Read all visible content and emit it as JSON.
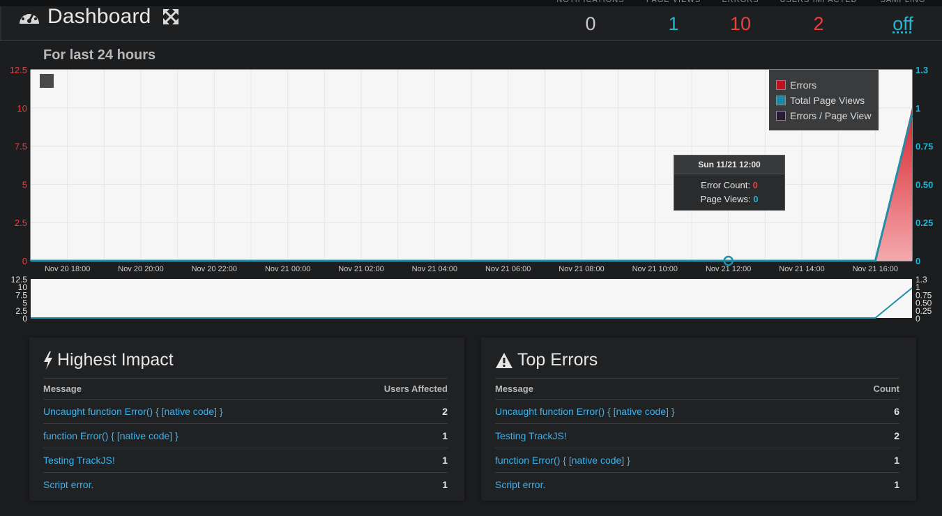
{
  "header": {
    "title": "Dashboard",
    "stats": [
      {
        "label": "NOTIFICATIONS",
        "value": "0",
        "color": "#c9c9c9"
      },
      {
        "label": "PAGE VIEWS",
        "value": "1",
        "color": "#21b8d8"
      },
      {
        "label": "ERRORS",
        "value": "10",
        "color": "#ef3e3e"
      },
      {
        "label": "USERS IMPACTED",
        "value": "2",
        "color": "#ef3e3e"
      },
      {
        "label": "SAMPLING",
        "value": "off",
        "color": "#21b8d8"
      }
    ]
  },
  "chart": {
    "subtitle": "For last 24 hours",
    "legend": [
      {
        "label": "Errors",
        "color": "#c0111f"
      },
      {
        "label": "Total Page Views",
        "color": "#1a8aa3"
      },
      {
        "label": "Errors / Page View",
        "color": "#2a1a33"
      }
    ],
    "tooltip": {
      "title": "Sun 11/21 12:00",
      "error_label": "Error Count:",
      "error_value": "0",
      "views_label": "Page Views:",
      "views_value": "0"
    }
  },
  "chart_data": {
    "type": "area",
    "x_labels": [
      "Nov 20 18:00",
      "Nov 20 20:00",
      "Nov 20 22:00",
      "Nov 21 00:00",
      "Nov 21 02:00",
      "Nov 21 04:00",
      "Nov 21 06:00",
      "Nov 21 08:00",
      "Nov 21 10:00",
      "Nov 21 12:00",
      "Nov 21 14:00",
      "Nov 21 16:00"
    ],
    "x": [
      "Nov 20 17:00",
      "Nov 20 18:00",
      "Nov 20 19:00",
      "Nov 20 20:00",
      "Nov 20 21:00",
      "Nov 20 22:00",
      "Nov 20 23:00",
      "Nov 21 00:00",
      "Nov 21 01:00",
      "Nov 21 02:00",
      "Nov 21 03:00",
      "Nov 21 04:00",
      "Nov 21 05:00",
      "Nov 21 06:00",
      "Nov 21 07:00",
      "Nov 21 08:00",
      "Nov 21 09:00",
      "Nov 21 10:00",
      "Nov 21 11:00",
      "Nov 21 12:00",
      "Nov 21 13:00",
      "Nov 21 14:00",
      "Nov 21 15:00",
      "Nov 21 16:00",
      "Nov 21 17:00"
    ],
    "series": [
      {
        "name": "Errors",
        "axis": "left",
        "values": [
          0,
          0,
          0,
          0,
          0,
          0,
          0,
          0,
          0,
          0,
          0,
          0,
          0,
          0,
          0,
          0,
          0,
          0,
          0,
          0,
          0,
          0,
          0,
          0,
          10
        ]
      },
      {
        "name": "Total Page Views",
        "axis": "right",
        "values": [
          0,
          0,
          0,
          0,
          0,
          0,
          0,
          0,
          0,
          0,
          0,
          0,
          0,
          0,
          0,
          0,
          0,
          0,
          0,
          0,
          0,
          0,
          0,
          0,
          1
        ]
      }
    ],
    "y_left": {
      "ticks": [
        "0",
        "2.5",
        "5",
        "7.5",
        "10",
        "12.5"
      ],
      "range": [
        0,
        12.5
      ]
    },
    "y_right": {
      "ticks": [
        "0",
        "0.25",
        "0.50",
        "0.75",
        "1",
        "1.3"
      ],
      "range": [
        0,
        1.3
      ]
    },
    "highlight_x": "Nov 21 12:00",
    "legend_position": "top-right",
    "grid": true
  },
  "highest_impact": {
    "title": "Highest Impact",
    "col_message": "Message",
    "col_value": "Users Affected",
    "rows": [
      {
        "message": "Uncaught function Error() { [native code] }",
        "value": "2"
      },
      {
        "message": "function Error() { [native code] }",
        "value": "1"
      },
      {
        "message": "Testing TrackJS!",
        "value": "1"
      },
      {
        "message": "Script error.",
        "value": "1"
      }
    ]
  },
  "top_errors": {
    "title": "Top Errors",
    "col_message": "Message",
    "col_value": "Count",
    "rows": [
      {
        "message": "Uncaught function Error() { [native code] }",
        "value": "6"
      },
      {
        "message": "Testing TrackJS!",
        "value": "2"
      },
      {
        "message": "function Error() { [native code] }",
        "value": "1"
      },
      {
        "message": "Script error.",
        "value": "1"
      }
    ]
  }
}
